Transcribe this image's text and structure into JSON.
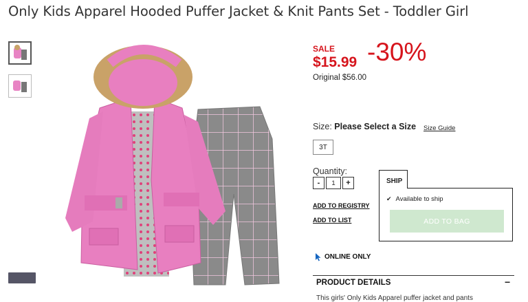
{
  "product": {
    "title": "Only Kids Apparel Hooded Puffer Jacket & Knit Pants Set - Toddler Girl"
  },
  "pricing": {
    "sale_label": "SALE",
    "sale_price": "$15.99",
    "discount": "-30%",
    "original": "Original $56.00",
    "accent_color": "#d6141c"
  },
  "size": {
    "label": "Size:",
    "prompt": "Please Select a Size",
    "guide": "Size Guide",
    "options": [
      "3T"
    ]
  },
  "quantity": {
    "label": "Quantity:",
    "minus": "-",
    "value": "1",
    "plus": "+"
  },
  "links": {
    "registry": "ADD TO REGISTRY",
    "list": "ADD TO LIST"
  },
  "ship": {
    "tab": "SHIP",
    "check_icon": "check-icon",
    "available": "Available to ship",
    "add_to_bag": "ADD TO BAG"
  },
  "online": {
    "icon": "cursor-arrow-icon",
    "label": "ONLINE ONLY"
  },
  "details": {
    "title": "PRODUCT DETAILS",
    "toggle": "−",
    "text": "This girls' Only Kids Apparel puffer jacket and pants"
  }
}
